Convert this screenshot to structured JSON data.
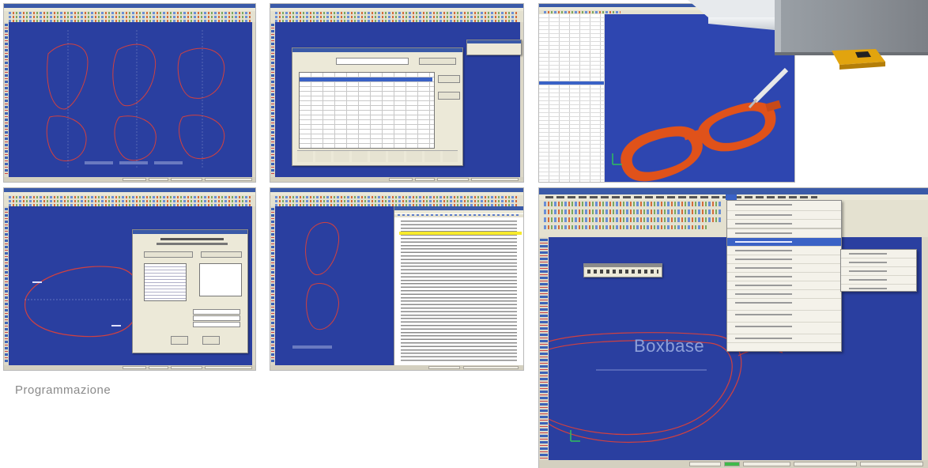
{
  "caption": "Programmazione",
  "large_screen": {
    "canvas_label": "Boxbase"
  },
  "colors": {
    "canvas_blue": "#2a3fa0",
    "lens_line": "#d04040",
    "frame_orange": "#e0521a",
    "menu_highlight": "#3a62c6",
    "chrome": "#ece9d8"
  }
}
